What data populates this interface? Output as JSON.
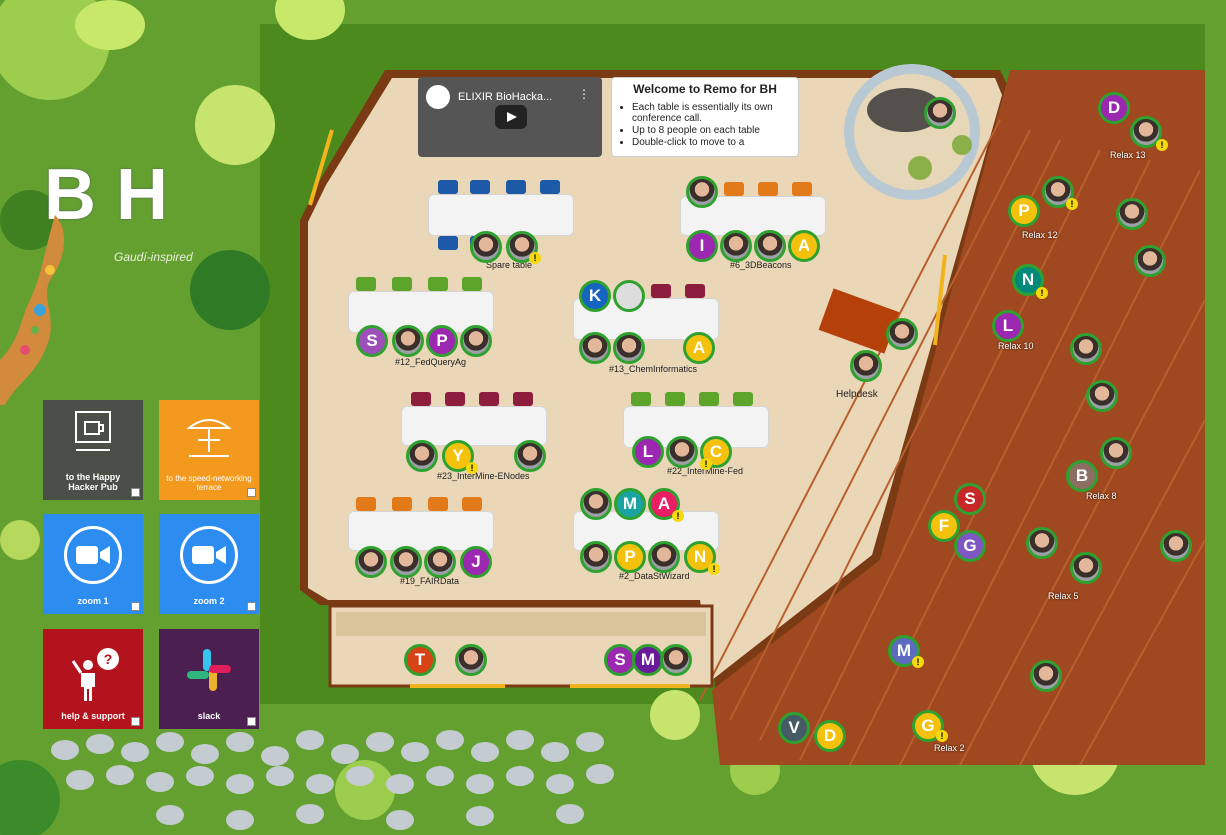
{
  "logo": {
    "letters": "BH",
    "tagline": "Gaudí-inspired"
  },
  "video": {
    "title": "ELIXIR BioHacka...",
    "channel_logo": "elixir"
  },
  "welcome": {
    "title": "Welcome to Remo for BH",
    "bullets": [
      "Each table is essentially its own conference call.",
      "Up to 8 people on each table",
      "Double-click to move to a"
    ]
  },
  "tiles": [
    {
      "label": "to the Happy Hacker Pub",
      "icon": "mug-sign-icon",
      "color": "#4a5048"
    },
    {
      "label": "to the speed-networking terrace",
      "icon": "parasol-table-icon",
      "color": "#f39a1e"
    },
    {
      "label": "zoom 1",
      "icon": "zoom-camera-icon",
      "color": "#2d8cf0"
    },
    {
      "label": "zoom 2",
      "icon": "zoom-camera-icon",
      "color": "#2d8cf0"
    },
    {
      "label": "help & support",
      "icon": "help-person-icon",
      "color": "#b3131c"
    },
    {
      "label": "slack",
      "icon": "slack-icon",
      "color": "#4b1f4f"
    }
  ],
  "tables": [
    "Spare table",
    "#6_3DBeacons",
    "#12_FedQueryAg",
    "#13_ChemInformatics",
    "Helpdesk",
    "#23_InterMine-ENodes",
    "#22_InterMine-Fed",
    "#19_FAIRData",
    "#2_DataStWizard"
  ],
  "relax": [
    "Relax 13",
    "Relax 12",
    "Relax 10",
    "Relax 8",
    "Relax 5",
    "Relax 2"
  ],
  "avatars": {
    "D": "D",
    "P": "P",
    "N": "N",
    "L": "L",
    "B": "B",
    "S": "S",
    "F": "F",
    "G": "G",
    "M": "M",
    "V": "V",
    "I": "I",
    "A": "A",
    "K": "K",
    "Y": "Y",
    "J": "J",
    "T": "T",
    "badge": "!"
  },
  "colors": {
    "grass": "#5f9a2e",
    "floor": "#ead7b8",
    "deck": "#a0481f",
    "ring": "#2fa12f"
  }
}
